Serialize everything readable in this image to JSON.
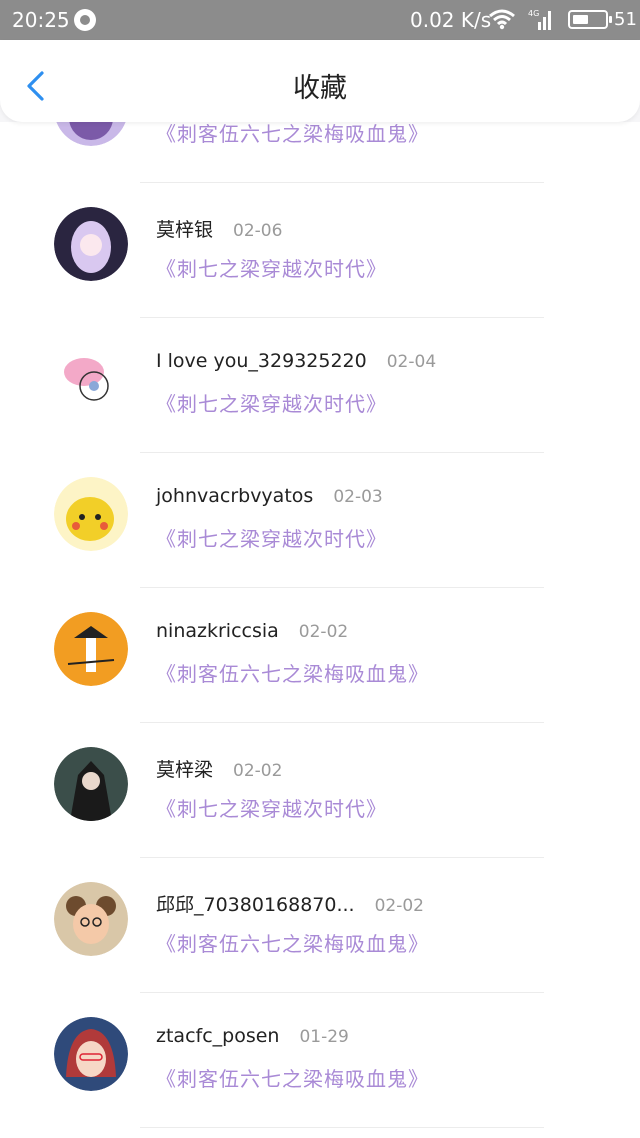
{
  "status_bar": {
    "time": "20:25",
    "speed": "0.02 K/s",
    "network_label": "4G",
    "battery_level": 0.51,
    "battery_text": "51"
  },
  "header": {
    "title": "收藏",
    "accent_color": "#2e8ff0"
  },
  "items": [
    {
      "name": "",
      "date": "",
      "book": "《刺客伍六七之梁梅吸血鬼》",
      "avatar": {
        "bg": "#c9b8e8",
        "fg": "#7b5aa8"
      }
    },
    {
      "name": "莫梓银",
      "date": "02-06",
      "book": "《刺七之梁穿越次时代》",
      "avatar": {
        "bg": "#2a2540",
        "fg": "#d9c8f0"
      }
    },
    {
      "name": "I love you_329325220",
      "date": "02-04",
      "book": "《刺七之梁穿越次时代》",
      "avatar": {
        "bg": "#ffffff",
        "fg": "#f3a9c8"
      }
    },
    {
      "name": "johnvacrbvyatos",
      "date": "02-03",
      "book": "《刺七之梁穿越次时代》",
      "avatar": {
        "bg": "#fdf4c6",
        "fg": "#f2cf28"
      }
    },
    {
      "name": "ninazkriccsia",
      "date": "02-02",
      "book": "《刺客伍六七之梁梅吸血鬼》",
      "avatar": {
        "bg": "#f29d22",
        "fg": "#ffffff"
      }
    },
    {
      "name": "莫梓梁",
      "date": "02-02",
      "book": "《刺七之梁穿越次时代》",
      "avatar": {
        "bg": "#3b4e4a",
        "fg": "#1a1a1a"
      }
    },
    {
      "name": "邱邱_70380168870...",
      "date": "02-02",
      "book": "《刺客伍六七之梁梅吸血鬼》",
      "avatar": {
        "bg": "#d9c7a8",
        "fg": "#6d4b2e"
      }
    },
    {
      "name": "ztacfc_posen",
      "date": "01-29",
      "book": "《刺客伍六七之梁梅吸血鬼》",
      "avatar": {
        "bg": "#2f4a7a",
        "fg": "#b13a3a"
      }
    }
  ]
}
